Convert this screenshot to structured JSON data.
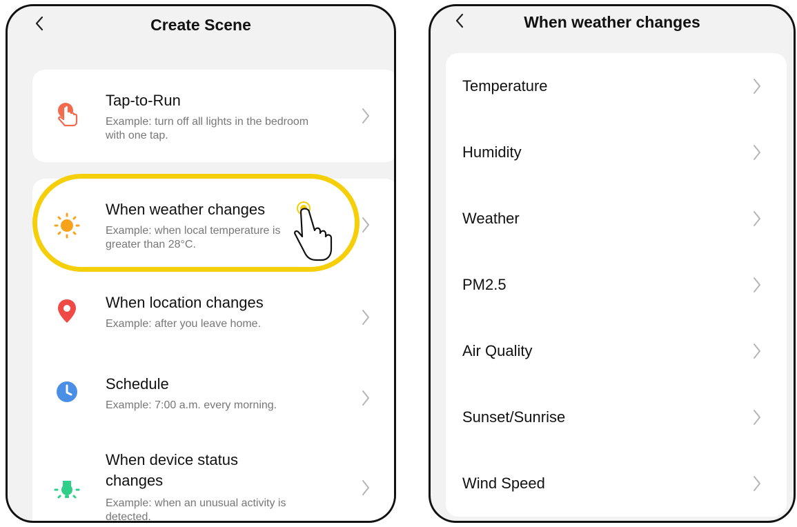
{
  "left_screen": {
    "title": "Create Scene",
    "options": [
      {
        "title": "Tap-to-Run",
        "desc": "Example: turn off all lights in the bedroom with one tap.",
        "icon": "tap-icon",
        "color": "#f26b4e"
      },
      {
        "title": "When weather changes",
        "desc": "Example: when local temperature is greater than 28°C.",
        "icon": "sun-icon",
        "color": "#f7a21b",
        "highlighted": true
      },
      {
        "title": "When location changes",
        "desc": "Example: after you leave home.",
        "icon": "location-pin-icon",
        "color": "#ef4a45"
      },
      {
        "title": "Schedule",
        "desc": "Example: 7:00 a.m. every morning.",
        "icon": "clock-icon",
        "color": "#4a8ee6"
      },
      {
        "title": "When device status changes",
        "desc": "Example: when an unusual activity is detected.",
        "icon": "device-bulb-icon",
        "color": "#2fcf8a"
      }
    ]
  },
  "right_screen": {
    "title": "When weather changes",
    "items": [
      "Temperature",
      "Humidity",
      "Weather",
      "PM2.5",
      "Air Quality",
      "Sunset/Sunrise",
      "Wind Speed"
    ]
  },
  "colors": {
    "highlight": "#f5cf0a",
    "background": "#f2f2f2",
    "card": "#ffffff"
  }
}
